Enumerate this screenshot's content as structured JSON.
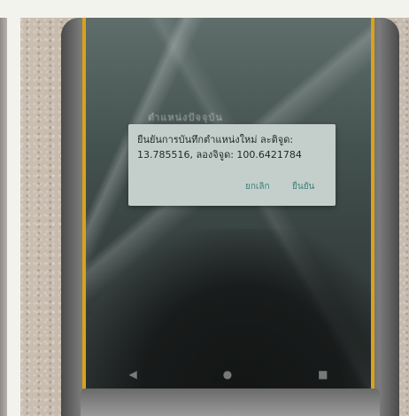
{
  "dialog": {
    "message": "ยืนยันการบันทึกตำแหน่งใหม่ ละติจูด: 13.785516, ลองจิจูด: 100.6421784",
    "cancel_label": "ยกเลิก",
    "confirm_label": "ยืนยัน"
  },
  "screen": {
    "blurred_title": "ตำแหน่งปัจจุบัน"
  },
  "navigation": {
    "back_icon": "◀",
    "home_icon": "●",
    "recent_icon": "■"
  }
}
